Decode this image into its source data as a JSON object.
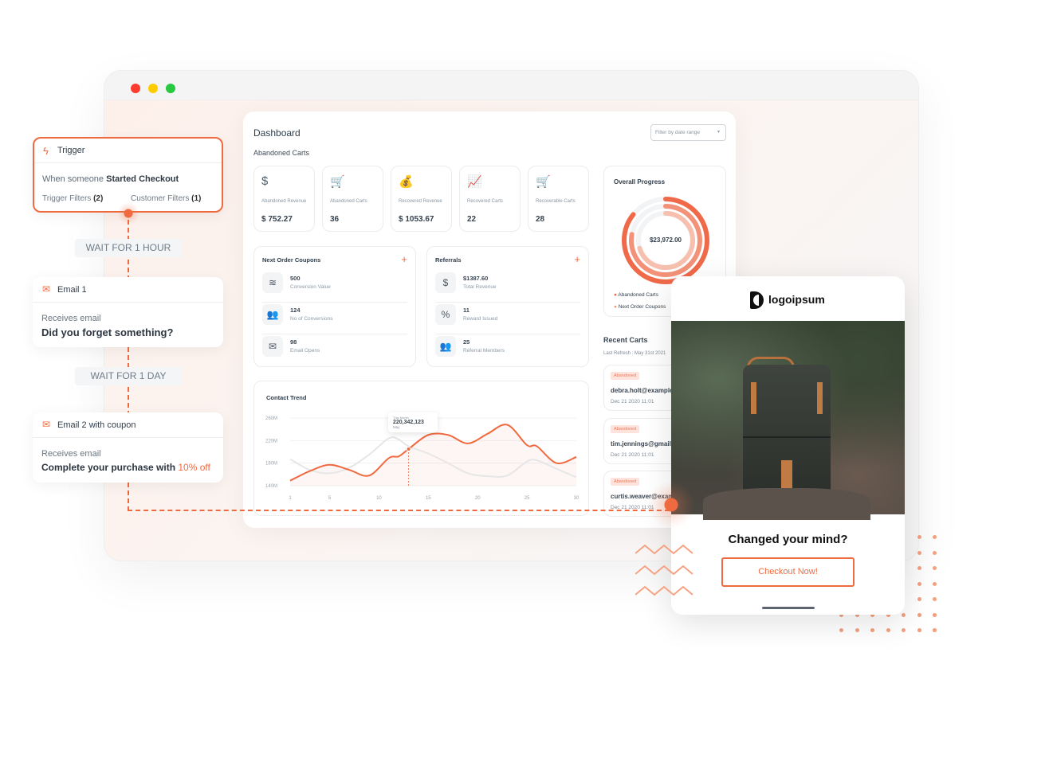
{
  "colors": {
    "accent": "#f06a3f",
    "traffic": [
      "#ff3b30",
      "#ffcc00",
      "#28c840"
    ]
  },
  "workflow": {
    "trigger": {
      "title": "Trigger",
      "icon": "lightning-icon",
      "desc_prefix": "When someone ",
      "desc_bold": "Started Checkout",
      "filters1": "Trigger Filters",
      "filters1_count": "(2)",
      "filters2": "Customer Filters",
      "filters2_count": "(1)"
    },
    "wait1": "WAIT FOR 1 HOUR",
    "email1": {
      "title": "Email 1",
      "sub": "Receives email",
      "subject": "Did you forget something?"
    },
    "wait2": "WAIT FOR 1 DAY",
    "email2": {
      "title": "Email 2 with coupon",
      "sub": "Receives email",
      "subject": "Complete your purchase with ",
      "highlight": "10% off"
    }
  },
  "dashboard": {
    "title": "Dashboard",
    "filter_placeholder": "Filter by date range",
    "section": "Abandoned Carts",
    "kpis": [
      {
        "label": "Abandoned Revenue",
        "value": "$ 752.27",
        "icon": "money-down-icon"
      },
      {
        "label": "Abandoned Carts",
        "value": "36",
        "icon": "cart-icon"
      },
      {
        "label": "Recovered Revenue",
        "value": "$ 1053.67",
        "icon": "money-bag-icon"
      },
      {
        "label": "Recovered Carts",
        "value": "22",
        "icon": "growth-chart-icon"
      },
      {
        "label": "Recoverable Carts",
        "value": "28",
        "icon": "cart-download-icon"
      }
    ],
    "coupons": {
      "title": "Next Order Coupons",
      "items": [
        {
          "value": "500",
          "label": "Conversion Value",
          "icon": "layers-icon"
        },
        {
          "value": "124",
          "label": "No of Conversions",
          "icon": "group-icon"
        },
        {
          "value": "98",
          "label": "Email Opens",
          "icon": "envelope-open-icon"
        }
      ]
    },
    "referrals": {
      "title": "Referrals",
      "items": [
        {
          "value": "$1387.60",
          "label": "Total Revenue",
          "icon": "hand-coin-icon"
        },
        {
          "value": "11",
          "label": "Reward Issued",
          "icon": "ticket-percent-icon"
        },
        {
          "value": "25",
          "label": "Referral Members",
          "icon": "users-icon"
        }
      ]
    },
    "progress": {
      "title": "Overall Progress",
      "total": "$23,972.00",
      "legend": [
        "Abandoned Carts",
        "Next Order Coupons"
      ]
    },
    "recent": {
      "title": "Recent Carts",
      "refresh": "Last Refresh : May 31st 2021",
      "items": [
        {
          "status": "Abandoned",
          "email": "debra.holt@example.com",
          "date": "Dec 21 2020 11:01"
        },
        {
          "status": "Abandoned",
          "email": "tim.jennings@gmail.com",
          "date": "Dec 21 2020 11:01"
        },
        {
          "status": "Abandoned",
          "email": "curtis.weaver@example.com",
          "date": "Dec 21 2020 11:01"
        }
      ]
    }
  },
  "chart_data": {
    "type": "line",
    "title": "Contact Trend",
    "ylim": [
      140,
      260
    ],
    "xlim": [
      1,
      30
    ],
    "yticks": [
      "140M",
      "180M",
      "220M",
      "260M"
    ],
    "ytick_values": [
      140,
      180,
      220,
      260
    ],
    "xticks": [
      "1",
      "5",
      "10",
      "15",
      "20",
      "25",
      "30"
    ],
    "xtick_values": [
      1,
      5,
      10,
      15,
      20,
      25,
      30
    ],
    "grid": true,
    "x": [
      1,
      3,
      5,
      7,
      9,
      11,
      12,
      13,
      15,
      17,
      19,
      21,
      23,
      25,
      26,
      28,
      30
    ],
    "series": [
      {
        "color": "#f06a3f",
        "values": [
          149,
          166,
          177,
          168,
          158,
          189,
          192,
          205,
          230,
          230,
          215,
          232,
          248,
          212,
          210,
          180,
          191
        ]
      },
      {
        "color": "#e6e6e8",
        "values": [
          187,
          168,
          162,
          172,
          195,
          224,
          222,
          210,
          197,
          180,
          162,
          157,
          158,
          183,
          185,
          170,
          155
        ]
      }
    ],
    "tooltip": {
      "label": "This Month",
      "value": "220,342,123",
      "sub": "May",
      "x": 13
    }
  },
  "email_mock": {
    "logo": "logoipsum",
    "headline": "Changed your mind?",
    "cta": "Checkout Now!"
  }
}
